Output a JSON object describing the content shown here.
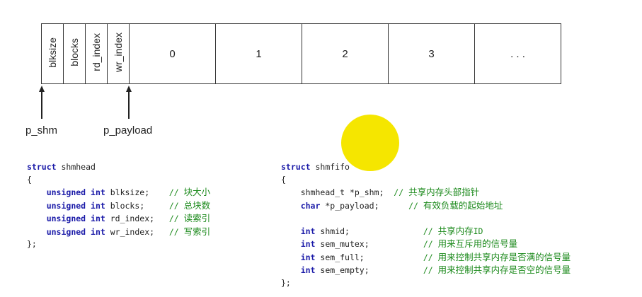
{
  "memory_layout": {
    "header_cells": [
      "blksize",
      "blocks",
      "rd_index",
      "wr_index"
    ],
    "payload_cells": [
      "0",
      "1",
      "2",
      "3",
      ". . ."
    ]
  },
  "pointers": {
    "p_shm": "p_shm",
    "p_payload": "p_payload"
  },
  "shmhead": {
    "decl": {
      "kw": "struct",
      "name": "shmhead"
    },
    "open": "{",
    "fields": [
      {
        "type": "unsigned int",
        "name": "blksize;",
        "comment": "块大小"
      },
      {
        "type": "unsigned int",
        "name": "blocks;",
        "comment": "总块数"
      },
      {
        "type": "unsigned int",
        "name": "rd_index;",
        "comment": "读索引"
      },
      {
        "type": "unsigned int",
        "name": "wr_index;",
        "comment": "写索引"
      }
    ],
    "close": "};"
  },
  "shmfifo": {
    "decl": {
      "kw": "struct",
      "name": "shmfifo"
    },
    "open": "{",
    "fields_a": [
      {
        "type": "shmhead_t",
        "name": "*p_shm;",
        "comment": "共享内存头部指针"
      },
      {
        "type": "char",
        "name": "*p_payload;",
        "comment": "有效负载的起始地址"
      }
    ],
    "fields_b": [
      {
        "type": "int",
        "name": "shmid;",
        "comment": "共享内存",
        "comment_suffix": "ID"
      },
      {
        "type": "int",
        "name": "sem_mutex;",
        "comment": "用来互斥用的信号量"
      },
      {
        "type": "int",
        "name": "sem_full;",
        "comment": "用来控制共享内存是否满的信号量"
      },
      {
        "type": "int",
        "name": "sem_empty;",
        "comment": "用来控制共享内存是否空的信号量"
      }
    ],
    "close": "};"
  }
}
